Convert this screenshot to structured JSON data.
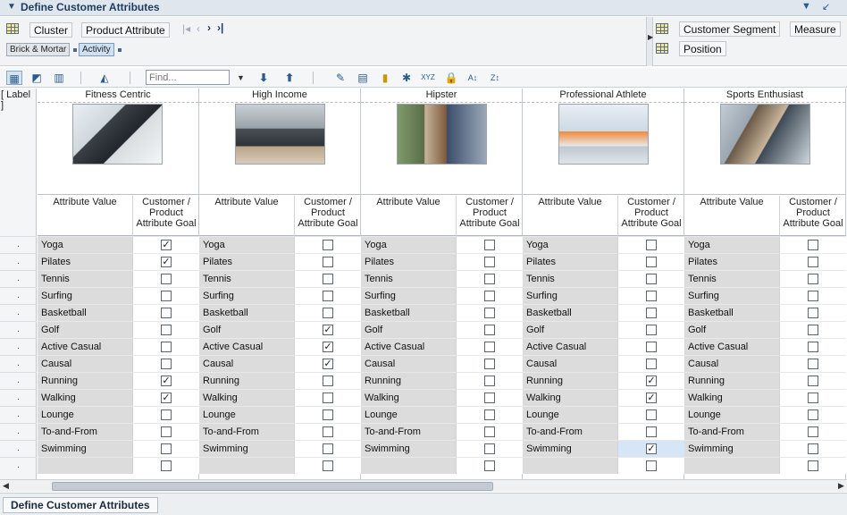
{
  "window": {
    "title": "Define Customer Attributes"
  },
  "dimensions": {
    "left_buttons": [
      "Cluster",
      "Product Attribute"
    ],
    "right_buttons": [
      "Customer Segment",
      "Measure",
      "Position"
    ],
    "tags": [
      "Brick & Mortar",
      "Activity"
    ]
  },
  "toolbar": {
    "find_placeholder": "Find..."
  },
  "grid": {
    "label_header": "[ Label ]",
    "row_marker": ".",
    "attr_header": "Attribute Value",
    "goal_header": "Customer / Product Attribute Goal",
    "check_mark": "✓",
    "segments": [
      {
        "name": "Fitness Centric",
        "photo": "tablet-photo",
        "checks": [
          true,
          true,
          false,
          false,
          false,
          false,
          false,
          false,
          true,
          true,
          false,
          false,
          false,
          false
        ]
      },
      {
        "name": "High Income",
        "photo": "reading-man-photo",
        "checks": [
          false,
          false,
          false,
          false,
          false,
          true,
          true,
          true,
          false,
          false,
          false,
          false,
          false,
          false
        ]
      },
      {
        "name": "Hipster",
        "photo": "street-man-photo",
        "checks": [
          false,
          false,
          false,
          false,
          false,
          false,
          false,
          false,
          false,
          false,
          false,
          false,
          false,
          false
        ]
      },
      {
        "name": "Professional Athlete",
        "photo": "runners-photo",
        "checks": [
          false,
          false,
          false,
          false,
          false,
          false,
          false,
          false,
          true,
          true,
          false,
          false,
          true,
          false
        ]
      },
      {
        "name": "Sports Enthusiast",
        "photo": "cyclist-photo",
        "checks": [
          false,
          false,
          false,
          false,
          false,
          false,
          false,
          false,
          false,
          false,
          false,
          false,
          false,
          false
        ]
      }
    ],
    "attributes": [
      "Yoga",
      "Pilates",
      "Tennis",
      "Surfing",
      "Basketball",
      "Golf",
      "Active Casual",
      "Causal",
      "Running",
      "Walking",
      "Lounge",
      "To-and-From",
      "Swimming",
      ""
    ]
  },
  "bottom_tab": {
    "label": "Define Customer Attributes"
  },
  "colors": {
    "value_cell": "#dcdcdc",
    "selected_cell": "#d7e6f6",
    "title_bar": "#dfe6ee"
  }
}
